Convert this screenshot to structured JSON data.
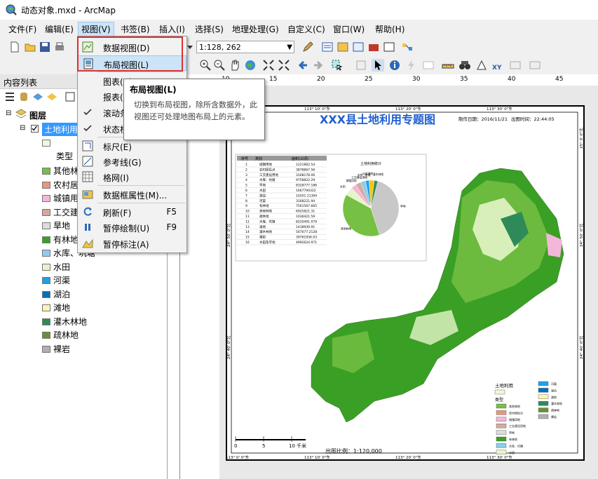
{
  "window": {
    "title": "动态对象.mxd - ArcMap"
  },
  "menubar": [
    {
      "label": "文件(F)"
    },
    {
      "label": "编辑(E)"
    },
    {
      "label": "视图(V)"
    },
    {
      "label": "书签(B)"
    },
    {
      "label": "插入(I)"
    },
    {
      "label": "选择(S)"
    },
    {
      "label": "地理处理(G)"
    },
    {
      "label": "自定义(C)"
    },
    {
      "label": "窗口(W)"
    },
    {
      "label": "帮助(H)"
    }
  ],
  "toolbar": {
    "scale": "1:128, 262"
  },
  "view_menu": {
    "items": [
      {
        "label": "数据视图(D)",
        "shortcut": "",
        "icon": "data-view-icon"
      },
      {
        "label": "布局视图(L)",
        "shortcut": "",
        "icon": "layout-view-icon"
      },
      {
        "label": "图表(R)",
        "shortcut": "",
        "icon": ""
      },
      {
        "label": "报表(R)",
        "shortcut": "",
        "icon": ""
      },
      {
        "label": "滚动条",
        "shortcut": "",
        "icon": "check-icon"
      },
      {
        "label": "状态栏",
        "shortcut": "",
        "icon": "check-icon"
      },
      {
        "label": "标尺(E)",
        "shortcut": "",
        "icon": "ruler-icon"
      },
      {
        "label": "参考线(G)",
        "shortcut": "",
        "icon": "guides-icon"
      },
      {
        "label": "格网(I)",
        "shortcut": "",
        "icon": "grid-icon"
      },
      {
        "label": "数据框属性(M)...",
        "shortcut": "",
        "icon": "frame-props-icon"
      },
      {
        "label": "刷新(F)",
        "shortcut": "F5",
        "icon": "refresh-icon"
      },
      {
        "label": "暂停绘制(U)",
        "shortcut": "F9",
        "icon": "pause-icon"
      },
      {
        "label": "暂停标注(A)",
        "shortcut": "",
        "icon": "pause-label-icon"
      }
    ]
  },
  "tooltip": {
    "title": "布局视图(L)",
    "body": "切换到布局视图，除所含数据外，此视图还可处理地图布局上的元素。"
  },
  "toc": {
    "header": "内容列表",
    "layers_label": "图层",
    "layer_name": "土地利用",
    "type_label": "类型",
    "legend": [
      {
        "label": "其他林地",
        "color": "#76c043"
      },
      {
        "label": "农村居民点",
        "color": "#e9967a"
      },
      {
        "label": "城镇用地",
        "color": "#f4b6d9"
      },
      {
        "label": "工交建设用地",
        "color": "#d6a99a"
      },
      {
        "label": "旱地",
        "color": "#dcdcdc"
      },
      {
        "label": "有林地",
        "color": "#3aa025"
      },
      {
        "label": "水库、坑塘",
        "color": "#8ecbf0"
      },
      {
        "label": "水田",
        "color": "#e6f5c8"
      },
      {
        "label": "河渠",
        "color": "#1ea0e8"
      },
      {
        "label": "湖泊",
        "color": "#0070c0"
      },
      {
        "label": "滩地",
        "color": "#fff3b0"
      },
      {
        "label": "灌木林地",
        "color": "#2f8a5a"
      },
      {
        "label": "疏林地",
        "color": "#6a8f3a"
      },
      {
        "label": "裸岩",
        "color": "#b0b0b0"
      }
    ]
  },
  "ruler": {
    "top": [
      "10",
      "15",
      "20",
      "25",
      "30",
      "35",
      "40",
      "45"
    ],
    "left": []
  },
  "map_layout": {
    "title": "XXX县土地利用专题图",
    "date_text": "制作日期：2016/11/21",
    "time_text": "出图时间：22:44:05",
    "scale_text": "出图比例：1:120,000",
    "scalebar": [
      "0",
      "5",
      "10 千米"
    ],
    "coords_top": [
      "113° 10' 0\"东",
      "113° 20' 0\"东",
      "113° 30' 0\"东"
    ],
    "coords_bottom": [
      "113° 0' 0\"东",
      "113° 10' 0\"东",
      "113° 20' 0\"东",
      "113° 30' 0\"东"
    ],
    "coords_left": [
      "24° 50' 0\"北",
      "24° 40' 0\"北"
    ],
    "coords_right": [
      "25° 0' 0\"北",
      "24° 50' 0\"北",
      "24° 40' 0\"北"
    ],
    "legend_title": "土地利用",
    "legend_type": "类型",
    "table_headers": [
      "序号",
      "类别",
      "面积(公顷)"
    ],
    "table_rows": [
      [
        "1",
        "城镇用地",
        "1221862.54"
      ],
      [
        "2",
        "农村居民点",
        "3878867.56"
      ],
      [
        "3",
        "工交建设用地",
        "3168178.06"
      ],
      [
        "4",
        "水库、坑塘",
        "9758822.29"
      ],
      [
        "5",
        "旱地",
        "8328777.186"
      ],
      [
        "6",
        "水田",
        "1667794322"
      ],
      [
        "7",
        "湖泊",
        "10201.11394"
      ],
      [
        "8",
        "河渠",
        "3168221.94"
      ],
      [
        "9",
        "有林地",
        "7561567.665"
      ],
      [
        "10",
        "其他林地",
        "6925821.31"
      ],
      [
        "11",
        "疏林地",
        "1036421.59"
      ],
      [
        "12",
        "水库、坑塘",
        "8220491.079"
      ],
      [
        "13",
        "滩地",
        "1438939.91"
      ],
      [
        "14",
        "灌木林地",
        "567077.2128"
      ],
      [
        "15",
        "裸岩",
        "39761936.03"
      ],
      [
        "16",
        "水田及旱地",
        "4992624.971"
      ]
    ],
    "pie_title": "土地利用统计",
    "pie_slices": [
      {
        "label": "旱地",
        "value": 41,
        "color": "#c8c8c8"
      },
      {
        "label": "其他林地",
        "value": 38,
        "color": "#76c043"
      },
      {
        "label": "水田",
        "value": 5,
        "color": "#e6f5c8"
      },
      {
        "label": "城镇用地",
        "value": 3,
        "color": "#f4b6d9"
      },
      {
        "label": "工交建设用地",
        "value": 3,
        "color": "#d6a99a"
      },
      {
        "label": "水库、坑塘",
        "value": 3,
        "color": "#8ecbf0"
      },
      {
        "label": "河渠",
        "value": 2,
        "color": "#1ea0e8"
      },
      {
        "label": "滩地",
        "value": 3,
        "color": "#f5c518"
      },
      {
        "label": "灌木林地",
        "value": 2,
        "color": "#2f8a5a"
      }
    ]
  }
}
